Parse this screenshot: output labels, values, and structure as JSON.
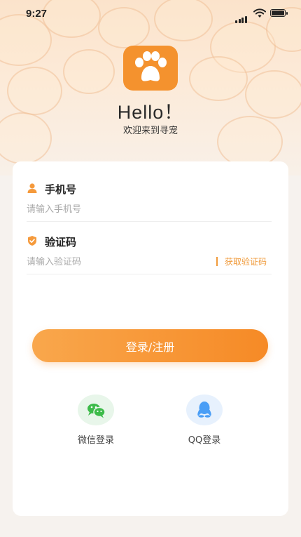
{
  "status_bar": {
    "time": "9:27"
  },
  "header": {
    "title": "Hello！",
    "subtitle": "欢迎来到寻宠"
  },
  "form": {
    "phone": {
      "label": "手机号",
      "placeholder": "请输入手机号",
      "value": ""
    },
    "code": {
      "label": "验证码",
      "placeholder": "请输入验证码",
      "value": "",
      "send_label": "获取验证码"
    },
    "submit_label": "登录/注册"
  },
  "social_login": [
    {
      "label": "微信登录",
      "icon": "wechat-icon",
      "color": "#3dbb4a"
    },
    {
      "label": "QQ登录",
      "icon": "qq-icon",
      "color": "#4a9ef6"
    }
  ],
  "colors": {
    "accent": "#f68a26",
    "logo": "#f4922e"
  }
}
